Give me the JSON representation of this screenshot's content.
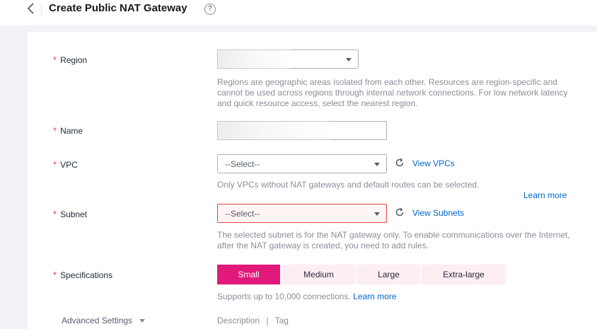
{
  "header": {
    "title": "Create Public NAT Gateway"
  },
  "region": {
    "label": "Region",
    "help": [
      "Regions are geographic areas isolated from each other. Resources are region-specific and",
      "cannot be used across regions through internal network connections. For low network latency",
      "and quick resource access, select the nearest region."
    ]
  },
  "name": {
    "label": "Name"
  },
  "vpc": {
    "label": "VPC",
    "placeholder": "--Select--",
    "view_link": "View VPCs",
    "help": "Only VPCs without NAT gateways and default routes can be selected.",
    "learn_more": "Learn more"
  },
  "subnet": {
    "label": "Subnet",
    "placeholder": "--Select--",
    "view_link": "View Subnets",
    "help": [
      "The selected subnet is for the NAT gateway only. To enable communications over the Internet,",
      "after the NAT gateway is created, you need to add rules."
    ]
  },
  "specifications": {
    "label": "Specifications",
    "options": [
      "Small",
      "Medium",
      "Large",
      "Extra-large"
    ],
    "selected": "Small",
    "help": "Supports up to 10,000 connections.",
    "learn_more": "Learn more"
  },
  "advanced": {
    "label": "Advanced Settings",
    "options_text": "Description",
    "separator": "|",
    "options_text2": "Tag"
  },
  "colors": {
    "accent": "#e0197a",
    "link": "#0066cc",
    "required": "#e54545"
  }
}
